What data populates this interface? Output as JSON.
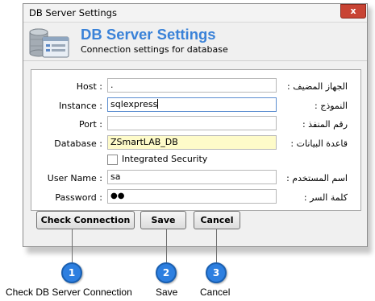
{
  "window": {
    "title": "DB Server Settings",
    "close_glyph": "x"
  },
  "header": {
    "icon": "database-settings-icon",
    "title": "DB Server Settings",
    "subtitle": "Connection settings for database"
  },
  "form": {
    "host": {
      "label": "Host :",
      "label_ar": "الجهاز المضيف :",
      "value": "."
    },
    "instance": {
      "label": "Instance :",
      "label_ar": "النموذج :",
      "value": "sqlexpress"
    },
    "port": {
      "label": "Port :",
      "label_ar": "رقم المنفذ :",
      "value": ""
    },
    "database": {
      "label": "Database :",
      "label_ar": "قاعدة البيانات :",
      "value": "ZSmartLAB_DB"
    },
    "integrated": {
      "label": "Integrated Security",
      "checked": false
    },
    "username": {
      "label": "User Name :",
      "label_ar": "اسم المستخدم :",
      "value": "sa"
    },
    "password": {
      "label": "Password :",
      "label_ar": "كلمة السر :",
      "value": "●●"
    }
  },
  "buttons": {
    "check": "Check Connection",
    "save": "Save",
    "cancel": "Cancel"
  },
  "callouts": [
    {
      "num": "1",
      "caption": "Check DB Server Connection"
    },
    {
      "num": "2",
      "caption": "Save"
    },
    {
      "num": "3",
      "caption": "Cancel"
    }
  ],
  "colors": {
    "accent": "#3a82d8",
    "callout": "#2d7fe0",
    "close": "#c84434",
    "highlight_field": "#fefbc9"
  }
}
